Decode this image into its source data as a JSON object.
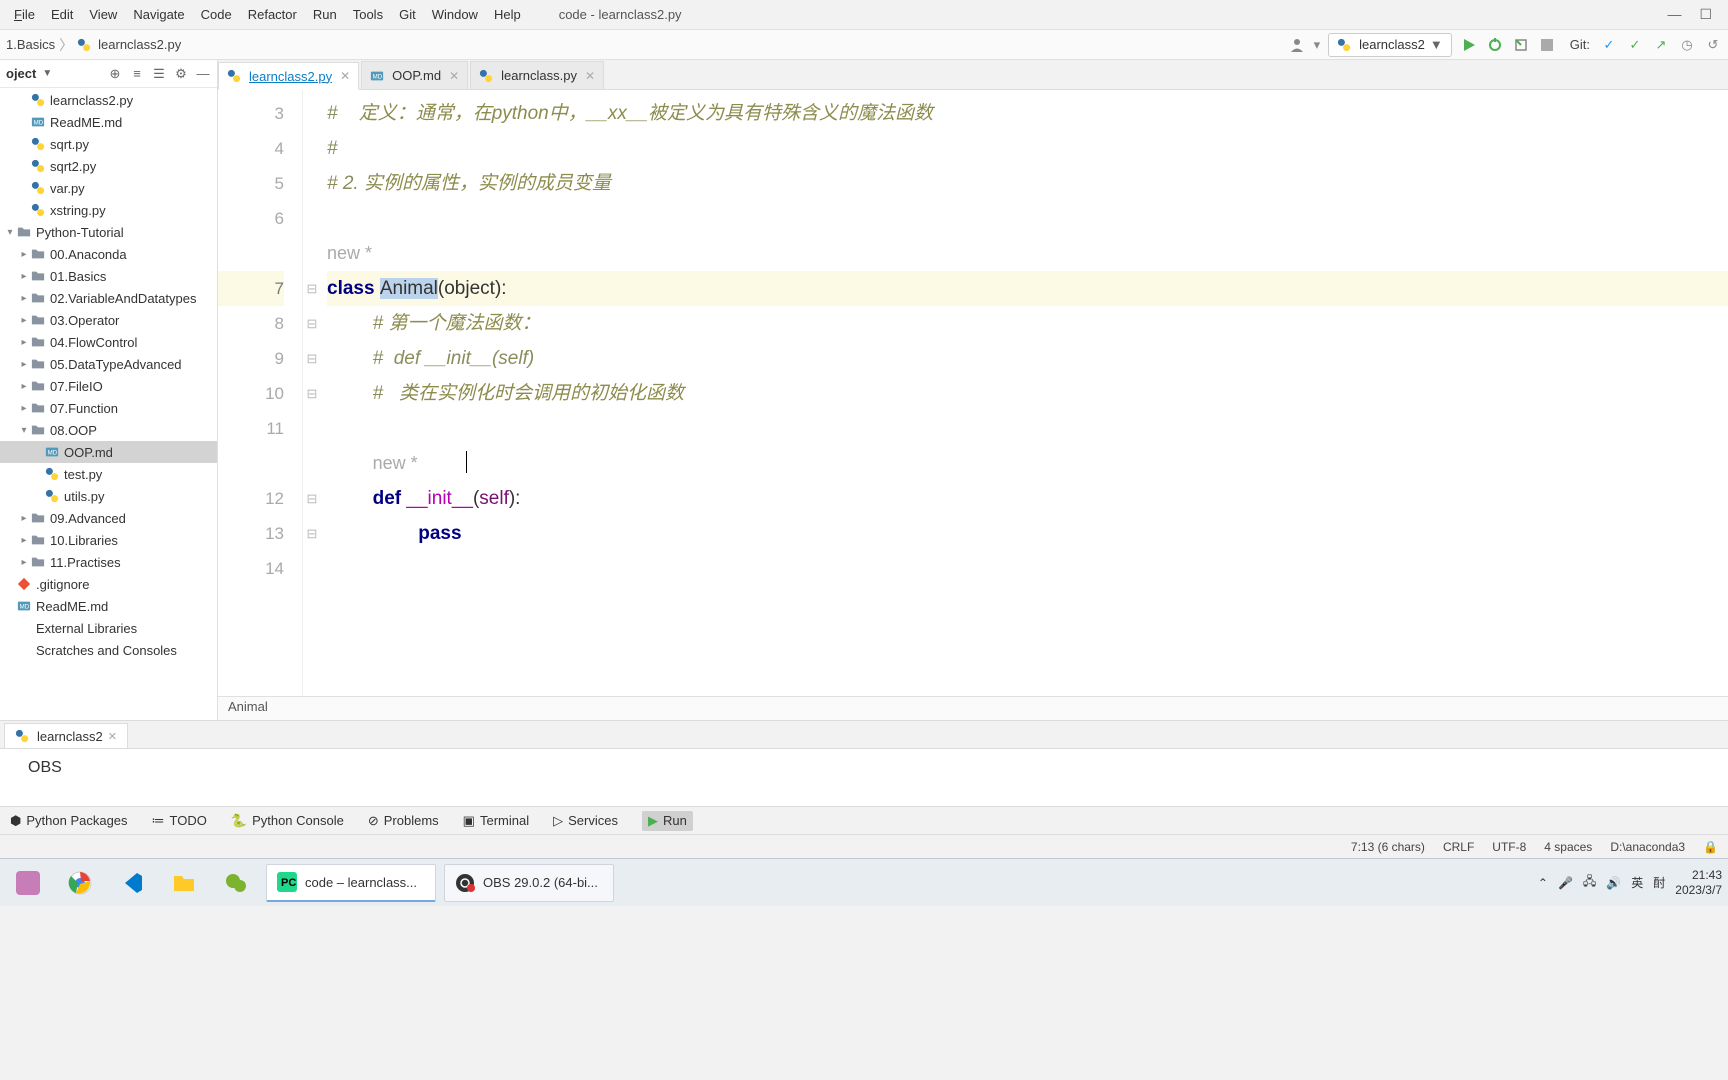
{
  "menubar": {
    "items": [
      "File",
      "Edit",
      "View",
      "Navigate",
      "Code",
      "Refactor",
      "Run",
      "Tools",
      "Git",
      "Window",
      "Help"
    ],
    "title": "code - learnclass2.py"
  },
  "breadcrumbs": {
    "parts": [
      "1.Basics",
      "learnclass2.py"
    ]
  },
  "run_config": {
    "name": "learnclass2"
  },
  "git_label": "Git:",
  "project_tree": {
    "header": "oject",
    "files_top": [
      "learnclass2.py",
      "ReadME.md",
      "sqrt.py",
      "sqrt2.py",
      "var.py",
      "xstring.py"
    ],
    "folder_tutorial": "Python-Tutorial",
    "subfolders": [
      "00.Anaconda",
      "01.Basics",
      "02.VariableAndDatatypes",
      "03.Operator",
      "04.FlowControl",
      "05.DataTypeAdvanced",
      "07.FileIO",
      "07.Function"
    ],
    "oop_folder": "08.OOP",
    "oop_children": [
      "OOP.md",
      "test.py",
      "utils.py"
    ],
    "subfolders2": [
      "09.Advanced",
      "10.Libraries",
      "11.Practises"
    ],
    "tail": [
      ".gitignore",
      "ReadME.md",
      "External Libraries",
      "Scratches and Consoles"
    ]
  },
  "tabs": [
    {
      "label": "learnclass2.py",
      "type": "py",
      "active": true
    },
    {
      "label": "OOP.md",
      "type": "md",
      "active": false
    },
    {
      "label": "learnclass.py",
      "type": "py",
      "active": false
    }
  ],
  "editor": {
    "line_numbers": [
      "3",
      "4",
      "5",
      "6",
      "",
      "7",
      "8",
      "9",
      "10",
      "11",
      "",
      "12",
      "13",
      "14"
    ],
    "line3": "#    定义：通常，在python中，__xx__被定义为具有特殊含义的魔法函数",
    "line4": "#",
    "line5": "# 2. 实例的属性，实例的成员变量",
    "new_hint1": "new *",
    "class_kw": "class ",
    "class_name": "Animal",
    "class_paren": "(",
    "class_base": "object",
    "class_end": "):",
    "line8": "# 第一个魔法函数：",
    "line9": "#  def __init__(self)",
    "line10": "#   类在实例化时会调用的初始化函数",
    "new_hint2": "new *",
    "def_kw": "def ",
    "init_name": "__init__",
    "init_paren": "(",
    "init_self": "self",
    "init_end": "):",
    "pass_kw": "pass",
    "breadcrumb": "Animal"
  },
  "run_tool": {
    "tab_label": "learnclass2",
    "output": "OBS"
  },
  "bottom_tools": [
    "Python Packages",
    "TODO",
    "Python Console",
    "Problems",
    "Terminal",
    "Services",
    "Run"
  ],
  "statusbar": {
    "pos": "7:13 (6 chars)",
    "eol": "CRLF",
    "enc": "UTF-8",
    "indent": "4 spaces",
    "interp": "D:\\anaconda3"
  },
  "taskbar": {
    "apps": [
      {
        "label": "code – learnclass...",
        "active": true
      },
      {
        "label": "OBS 29.0.2 (64-bi...",
        "active": false
      }
    ],
    "ime": "英",
    "ime2": "酎",
    "time": "21:43",
    "date": "2023/3/7"
  }
}
